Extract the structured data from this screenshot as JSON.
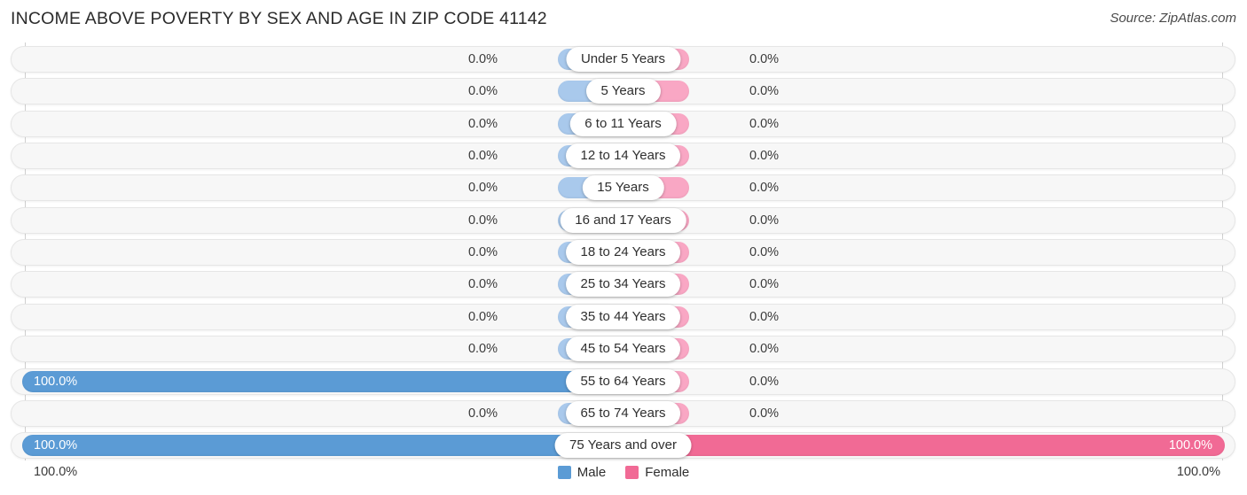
{
  "header": {
    "title": "INCOME ABOVE POVERTY BY SEX AND AGE IN ZIP CODE 41142",
    "source": "Source: ZipAtlas.com"
  },
  "legend": {
    "male_label": "Male",
    "female_label": "Female",
    "male_color": "#5b9bd5",
    "female_color": "#f16a95"
  },
  "footer": {
    "left_axis_label": "100.0%",
    "right_axis_label": "100.0%"
  },
  "chart_data": {
    "type": "bar",
    "title": "INCOME ABOVE POVERTY BY SEX AND AGE IN ZIP CODE 41142",
    "subtitle": "",
    "xlabel": "",
    "ylabel": "",
    "orientation": "horizontal-diverging",
    "grid": false,
    "legend_position": "bottom-center",
    "axis_min_label": "100.0%",
    "axis_max_label": "100.0%",
    "xlim": [
      0,
      100
    ],
    "categories": [
      "Under 5 Years",
      "5 Years",
      "6 to 11 Years",
      "12 to 14 Years",
      "15 Years",
      "16 and 17 Years",
      "18 to 24 Years",
      "25 to 34 Years",
      "35 to 44 Years",
      "45 to 54 Years",
      "55 to 64 Years",
      "65 to 74 Years",
      "75 Years and over"
    ],
    "series": [
      {
        "name": "Male",
        "color": "#5b9bd5",
        "values": [
          0.0,
          0.0,
          0.0,
          0.0,
          0.0,
          0.0,
          0.0,
          0.0,
          0.0,
          0.0,
          100.0,
          0.0,
          100.0
        ],
        "labels": [
          "0.0%",
          "0.0%",
          "0.0%",
          "0.0%",
          "0.0%",
          "0.0%",
          "0.0%",
          "0.0%",
          "0.0%",
          "0.0%",
          "100.0%",
          "0.0%",
          "100.0%"
        ]
      },
      {
        "name": "Female",
        "color": "#f16a95",
        "values": [
          0.0,
          0.0,
          0.0,
          0.0,
          0.0,
          0.0,
          0.0,
          0.0,
          0.0,
          0.0,
          0.0,
          0.0,
          100.0
        ],
        "labels": [
          "0.0%",
          "0.0%",
          "0.0%",
          "0.0%",
          "0.0%",
          "0.0%",
          "0.0%",
          "0.0%",
          "0.0%",
          "0.0%",
          "0.0%",
          "0.0%",
          "100.0%"
        ]
      }
    ]
  }
}
